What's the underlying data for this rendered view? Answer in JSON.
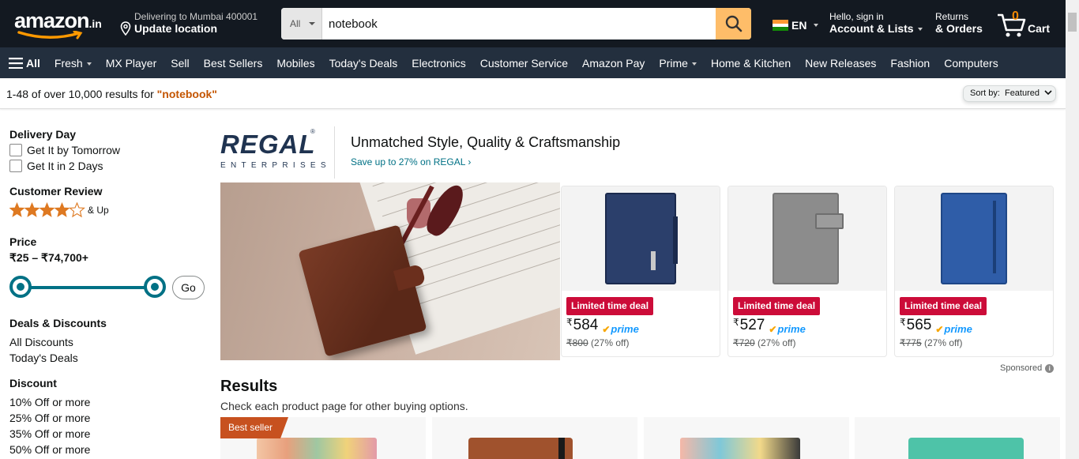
{
  "header": {
    "logo_text": "amazon",
    "logo_suffix": ".in",
    "deliver_line1": "Delivering to Mumbai 400001",
    "deliver_line2": "Update location",
    "search_category": "All",
    "search_value": "notebook",
    "language": "EN",
    "account_line1": "Hello, sign in",
    "account_line2": "Account & Lists",
    "returns_line1": "Returns",
    "returns_line2": "& Orders",
    "cart_count": "0",
    "cart_label": "Cart"
  },
  "nav": {
    "all_label": "All",
    "items": [
      "Fresh",
      "MX Player",
      "Sell",
      "Best Sellers",
      "Mobiles",
      "Today's Deals",
      "Electronics",
      "Customer Service",
      "Amazon Pay",
      "Prime",
      "Home & Kitchen",
      "New Releases",
      "Fashion",
      "Computers"
    ]
  },
  "results_bar": {
    "prefix": "1-48 of over 10,000 results for ",
    "query": "\"notebook\"",
    "sort_label": "Sort by:",
    "sort_value": "Featured"
  },
  "sidebar": {
    "delivery_heading": "Delivery Day",
    "delivery_options": [
      "Get It by Tomorrow",
      "Get It in 2 Days"
    ],
    "review_heading": "Customer Review",
    "review_suffix": "& Up",
    "review_stars": 4,
    "price_heading": "Price",
    "price_range": "₹25 – ₹74,700+",
    "go_label": "Go",
    "deals_heading": "Deals & Discounts",
    "deals_links": [
      "All Discounts",
      "Today's Deals"
    ],
    "discount_heading": "Discount",
    "discount_links": [
      "10% Off or more",
      "25% Off or more",
      "35% Off or more",
      "50% Off or more"
    ]
  },
  "brand": {
    "logo_main": "REGAL",
    "logo_sub": "ENTERPRISES",
    "logo_reg": "®",
    "headline": "Unmatched Style, Quality & Craftsmanship",
    "link": "Save up to 27% on REGAL ›"
  },
  "sponsored_products": [
    {
      "deal": "Limited time deal",
      "symbol": "₹",
      "price": "584",
      "prime": "prime",
      "was": "₹800",
      "off": "(27% off)",
      "color": "#2b3f6b"
    },
    {
      "deal": "Limited time deal",
      "symbol": "₹",
      "price": "527",
      "prime": "prime",
      "was": "₹720",
      "off": "(27% off)",
      "color": "#8c8c8c"
    },
    {
      "deal": "Limited time deal",
      "symbol": "₹",
      "price": "565",
      "prime": "prime",
      "was": "₹775",
      "off": "(27% off)",
      "color": "#2f5da8"
    }
  ],
  "sponsored_label": "Sponsored",
  "results": {
    "heading": "Results",
    "subheading": "Check each product page for other buying options.",
    "badge": "Best seller"
  },
  "colors": {
    "header_bg": "#131921",
    "nav_bg": "#232f3e",
    "search_button": "#febd69",
    "accent_teal": "#007185",
    "deal_red": "#cc0c39",
    "best_seller_orange": "#c7511f"
  }
}
